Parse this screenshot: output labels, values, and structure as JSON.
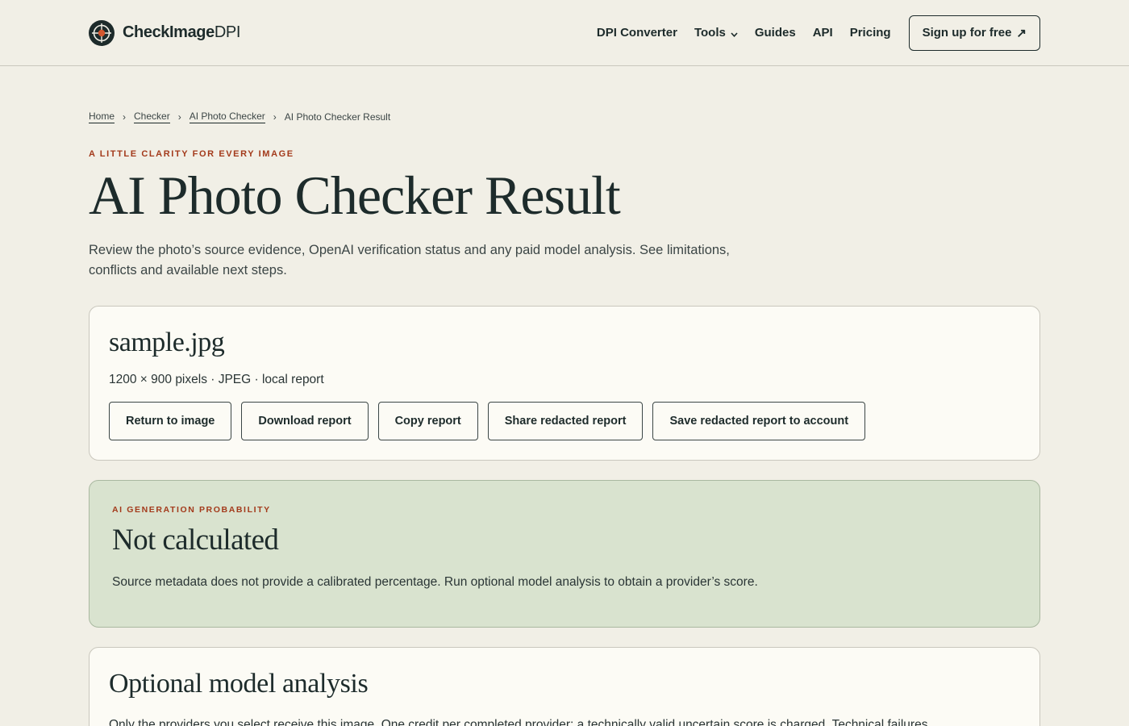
{
  "brand": {
    "name_bold": "CheckImage",
    "name_light": "DPI"
  },
  "nav": {
    "items": [
      "DPI Converter",
      "Tools",
      "Guides",
      "API",
      "Pricing"
    ],
    "signup_label": "Sign up for free",
    "signup_arrow": "↗"
  },
  "breadcrumb": {
    "items": [
      "Home",
      "Checker",
      "AI Photo Checker"
    ],
    "current": "AI Photo Checker Result",
    "separator": "›"
  },
  "hero": {
    "eyebrow": "A little clarity for every image",
    "title": "AI Photo Checker Result",
    "lede": "Review the photo’s source evidence, OpenAI verification status and any paid model analysis. See limitations, conflicts and available next steps."
  },
  "file_card": {
    "filename": "sample.jpg",
    "meta": "1200 × 900 pixels · JPEG · local report",
    "actions": [
      "Return to image",
      "Download report",
      "Copy report",
      "Share redacted report",
      "Save redacted report to account"
    ]
  },
  "probability": {
    "eyebrow": "AI generation probability",
    "value": "Not calculated",
    "description": "Source metadata does not provide a calibrated percentage. Run optional model analysis to obtain a provider’s score."
  },
  "model_analysis": {
    "title": "Optional model analysis",
    "description": "Only the providers you select receive this image. One credit per completed provider; a technically valid uncertain score is charged. Technical failures"
  },
  "colors": {
    "background": "#f1efe6",
    "ink": "#1d2b2b",
    "accent": "#a33a1b",
    "probability_bg": "#d9e3cf",
    "card_bg": "#fcfbf5"
  },
  "icons": {
    "logo": "crosshair-logo-icon",
    "tools_dropdown": "chevron-down-icon",
    "signup": "external-arrow-icon"
  }
}
